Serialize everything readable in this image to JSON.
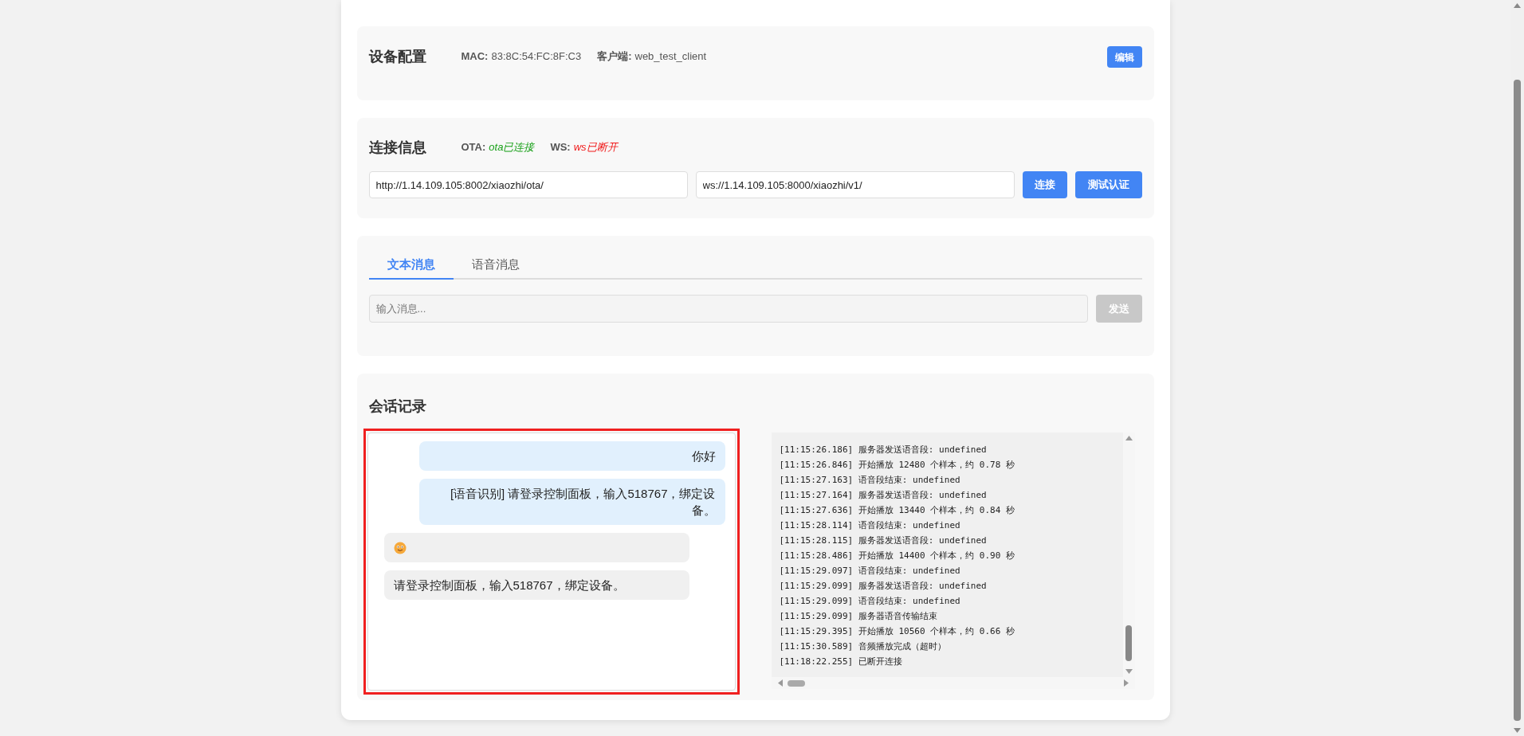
{
  "device_config": {
    "title": "设备配置",
    "mac_label": "MAC:",
    "mac": "83:8C:54:FC:8F:C3",
    "client_label": "客户端:",
    "client": "web_test_client",
    "edit_button": "编辑"
  },
  "connection": {
    "title": "连接信息",
    "ota_label": "OTA:",
    "ota_status": "ota已连接",
    "ota_connected": true,
    "ws_label": "WS:",
    "ws_status": "ws已断开",
    "ws_connected": false,
    "ota_url": "http://1.14.109.105:8002/xiaozhi/ota/",
    "ws_url": "ws://1.14.109.105:8000/xiaozhi/v1/",
    "connect_button": "连接",
    "auth_button": "测试认证"
  },
  "message": {
    "tabs": [
      {
        "label": "文本消息",
        "selected": true
      },
      {
        "label": "语音消息",
        "selected": false
      }
    ],
    "placeholder": "输入消息...",
    "send_button": "发送",
    "send_disabled": true
  },
  "conversation": {
    "title": "会话记录",
    "messages": [
      {
        "kind": "user",
        "text": "你好"
      },
      {
        "kind": "user",
        "text": "[语音识别] 请登录控制面板，输入518767，绑定设备。"
      },
      {
        "kind": "emoji"
      },
      {
        "kind": "bot",
        "text": "请登录控制面板，输入518767，绑定设备。"
      }
    ],
    "log": [
      "[11:15:26.186] 服务器发送语音段: undefined",
      "[11:15:26.846] 开始播放 12480 个样本，约 0.78 秒",
      "[11:15:27.163] 语音段结束: undefined",
      "[11:15:27.164] 服务器发送语音段: undefined",
      "[11:15:27.636] 开始播放 13440 个样本，约 0.84 秒",
      "[11:15:28.114] 语音段结束: undefined",
      "[11:15:28.115] 服务器发送语音段: undefined",
      "[11:15:28.486] 开始播放 14400 个样本，约 0.90 秒",
      "[11:15:29.097] 语音段结束: undefined",
      "[11:15:29.099] 服务器发送语音段: undefined",
      "[11:15:29.099] 语音段结束: undefined",
      "[11:15:29.099] 服务器语音传输结束",
      "[11:15:29.395] 开始播放 10560 个样本，约 0.66 秒",
      "[11:15:30.589] 音频播放完成（超时）",
      "[11:18:22.255] 已断开连接"
    ]
  }
}
